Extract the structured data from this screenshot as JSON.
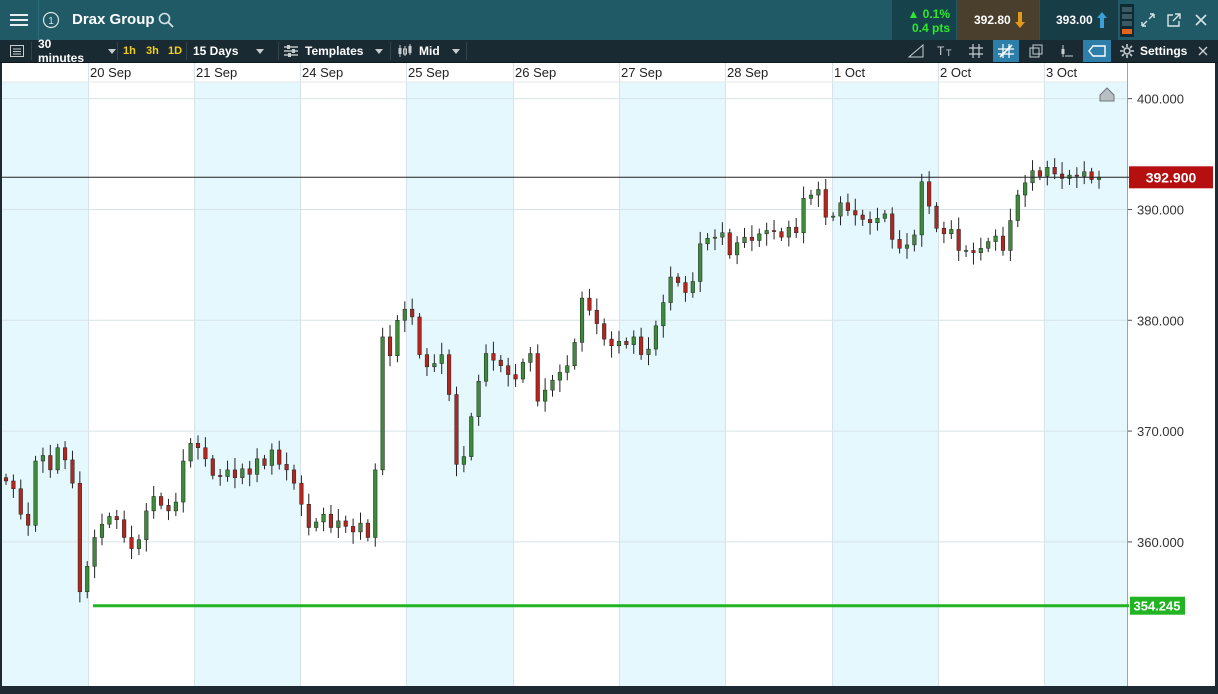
{
  "header": {
    "title": "Drax Group",
    "change_percent": "▲ 0.1%",
    "change_points": "0.4 pts",
    "sell_price": "392.80",
    "buy_price": "393.00",
    "icons": [
      "hamburger-menu-icon",
      "info-icon",
      "search-icon",
      "down-arrow-icon",
      "up-arrow-icon",
      "expand-icon",
      "popout-icon",
      "close-icon"
    ]
  },
  "toolbar": {
    "interval": "30 minutes",
    "btn_1h": "1h",
    "btn_3h": "3h",
    "btn_1d": "1D",
    "range": "15 Days",
    "templates": "Templates",
    "price_type": "Mid",
    "settings": "Settings"
  },
  "colors": {
    "bullish": "#3d8a3a",
    "bearish": "#b1261e",
    "band": "#e5f8fd",
    "current_price_badge": "#b50f0f",
    "support_line": "#22b422"
  },
  "chart_data": {
    "type": "candlestick",
    "title": "",
    "x_tick_labels": [
      "20 Sep",
      "21 Sep",
      "24 Sep",
      "25 Sep",
      "26 Sep",
      "27 Sep",
      "28 Sep",
      "1 Oct",
      "2 Oct",
      "3 Oct"
    ],
    "y_tick_labels": [
      "400.000",
      "390.000",
      "380.000",
      "370.000",
      "360.000"
    ],
    "y_ticks": [
      400,
      390,
      380,
      370,
      360
    ],
    "ylim": [
      347,
      401.5
    ],
    "current_price": 392.9,
    "current_price_label": "392.900",
    "support_level": 354.245,
    "support_label": "354.245",
    "shaded_days": [
      "19 Sep",
      "21 Sep",
      "25 Sep",
      "27 Sep",
      "1 Oct",
      "3 Oct"
    ],
    "closes": [
      365.5,
      364.8,
      362.5,
      361.5,
      367.3,
      367.8,
      366.5,
      368.5,
      367.4,
      365.3,
      355.5,
      357.8,
      360.4,
      361.6,
      362.3,
      362.0,
      360.4,
      359.4,
      360.2,
      362.8,
      364.1,
      363.3,
      362.8,
      363.6,
      367.3,
      368.9,
      368.5,
      367.5,
      366.0,
      365.9,
      366.5,
      365.8,
      366.6,
      366.1,
      367.5,
      366.9,
      368.3,
      367.0,
      366.5,
      365.3,
      363.4,
      361.3,
      361.8,
      362.5,
      361.3,
      361.9,
      361.4,
      360.9,
      361.7,
      360.4,
      366.5,
      378.5,
      376.8,
      380.0,
      381.0,
      380.3,
      376.9,
      375.8,
      376.1,
      376.9,
      373.3,
      367.0,
      367.7,
      371.3,
      374.5,
      377.0,
      376.4,
      375.9,
      375.1,
      374.7,
      376.2,
      377.0,
      372.7,
      373.7,
      374.6,
      375.3,
      375.9,
      378.0,
      382.0,
      380.9,
      379.7,
      378.3,
      377.7,
      378.1,
      377.8,
      378.5,
      376.9,
      377.4,
      379.5,
      381.6,
      383.9,
      383.4,
      382.5,
      383.5,
      386.9,
      387.4,
      387.5,
      387.9,
      385.9,
      387.0,
      387.5,
      387.2,
      387.8,
      388.1,
      388.0,
      387.5,
      388.4,
      387.9,
      391.0,
      391.3,
      391.8,
      389.3,
      389.4,
      390.6,
      389.9,
      389.5,
      389.1,
      388.8,
      389.2,
      389.6,
      387.3,
      386.5,
      386.8,
      387.7,
      392.5,
      390.3,
      388.3,
      387.8,
      388.2,
      386.3,
      386.3,
      386.1,
      386.5,
      387.1,
      387.6,
      386.3,
      389.0,
      391.3,
      392.4,
      393.5,
      393.0,
      393.8,
      393.2,
      392.8,
      393.1,
      393.0,
      393.4,
      392.7,
      392.9
    ]
  }
}
